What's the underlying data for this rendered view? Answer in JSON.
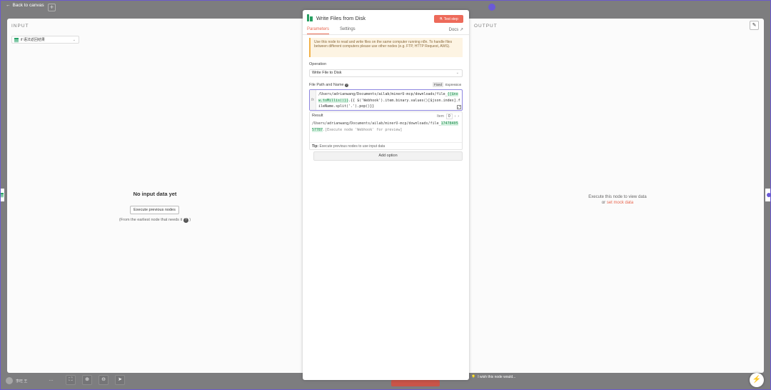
{
  "topbar": {
    "back_label": "Back to canvas",
    "plus": "+"
  },
  "input_pane": {
    "title": "INPUT",
    "run_select_value": "if 语法返回结果",
    "empty_title": "No input data yet",
    "execute_prev_label": "Execute previous nodes",
    "earliest_note": "(From the earliest node that needs it",
    "earliest_close": ")"
  },
  "output_pane": {
    "title": "OUTPUT",
    "msg_line1": "Execute this node to view data",
    "msg_or": "or ",
    "mock_link": "set mock data"
  },
  "node_panel": {
    "title": "Write Files from Disk",
    "test_step_label": "Test step",
    "tabs": [
      {
        "label": "Parameters"
      },
      {
        "label": "Settings"
      }
    ],
    "docs_label": "Docs",
    "notice": "Use this node to read and write files on the same computer running n8n. To handle files between different computers please use other nodes (e.g. FTP, HTTP Request, AWS).",
    "operation_label": "Operation",
    "operation_value": "Write File to Disk",
    "file_path_label": "File Path and Name",
    "toggle_fixed": "Fixed",
    "toggle_expression": "Expression",
    "fx_label": "fx",
    "expr_part1": "/Users/adrianwang/Documents/ailab/minerU-mcp/downloads/file_",
    "expr_part2": "{{$now.toMillis()}}",
    "expr_part3": ".{{ $('Webhook').item.binary.values()[$json.index].fileName.split('.').pop()}}",
    "result_label": "Result",
    "item_label": "Item",
    "item_value": "0",
    "result_part1": "/Users/adrianwang/Documents/ailab/minerU-mcp/downloads/file_",
    "result_part2": "1747840557787",
    "result_part3": ".[Execute node 'Webhook' for preview]",
    "tip_bold": "Tip:",
    "tip_text": " Execute previous nodes to use input data",
    "add_option_label": "Add option"
  },
  "bottombar": {
    "user": "李旺 王",
    "dots": "…",
    "feedback": "I wish this node would..."
  },
  "colors": {
    "accent": "#e8664f",
    "brand_purple": "#6b5ad8",
    "node_green": "#27a062"
  }
}
